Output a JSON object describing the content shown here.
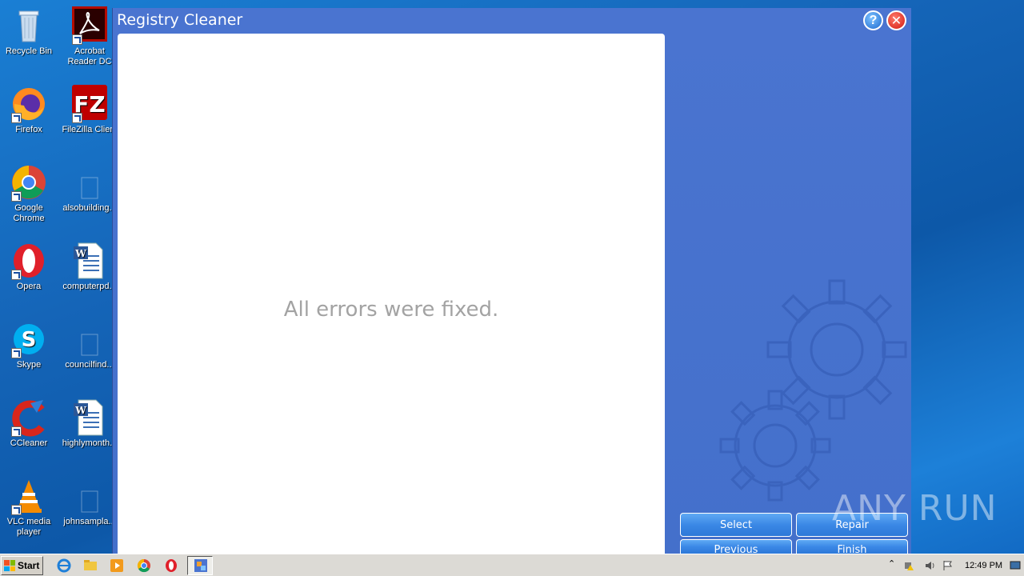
{
  "desktop": {
    "icons": [
      {
        "label": "Recycle Bin"
      },
      {
        "label": "Acrobat Reader DC"
      },
      {
        "label": "Firefox"
      },
      {
        "label": "FileZilla Client"
      },
      {
        "label": "Google Chrome"
      },
      {
        "label": "alsobuilding..."
      },
      {
        "label": "Opera"
      },
      {
        "label": "computerpd..."
      },
      {
        "label": "Skype"
      },
      {
        "label": "councilfind..."
      },
      {
        "label": "CCleaner"
      },
      {
        "label": "highlymonth..."
      },
      {
        "label": "VLC media player"
      },
      {
        "label": "johnsampla..."
      }
    ]
  },
  "window": {
    "title": "Registry Cleaner",
    "help_label": "?",
    "close_label": "✕",
    "message": "All errors were fixed.",
    "buttons": {
      "select": "Select",
      "repair": "Repair",
      "previous": "Previous",
      "finish": "Finish"
    }
  },
  "watermark": "ANY RUN",
  "taskbar": {
    "start_label": "Start",
    "clock": "12:49 PM"
  },
  "colors": {
    "window_bg": "#4571cd",
    "button_bg": "#3b88e6",
    "message_color": "#a3a3a3"
  }
}
